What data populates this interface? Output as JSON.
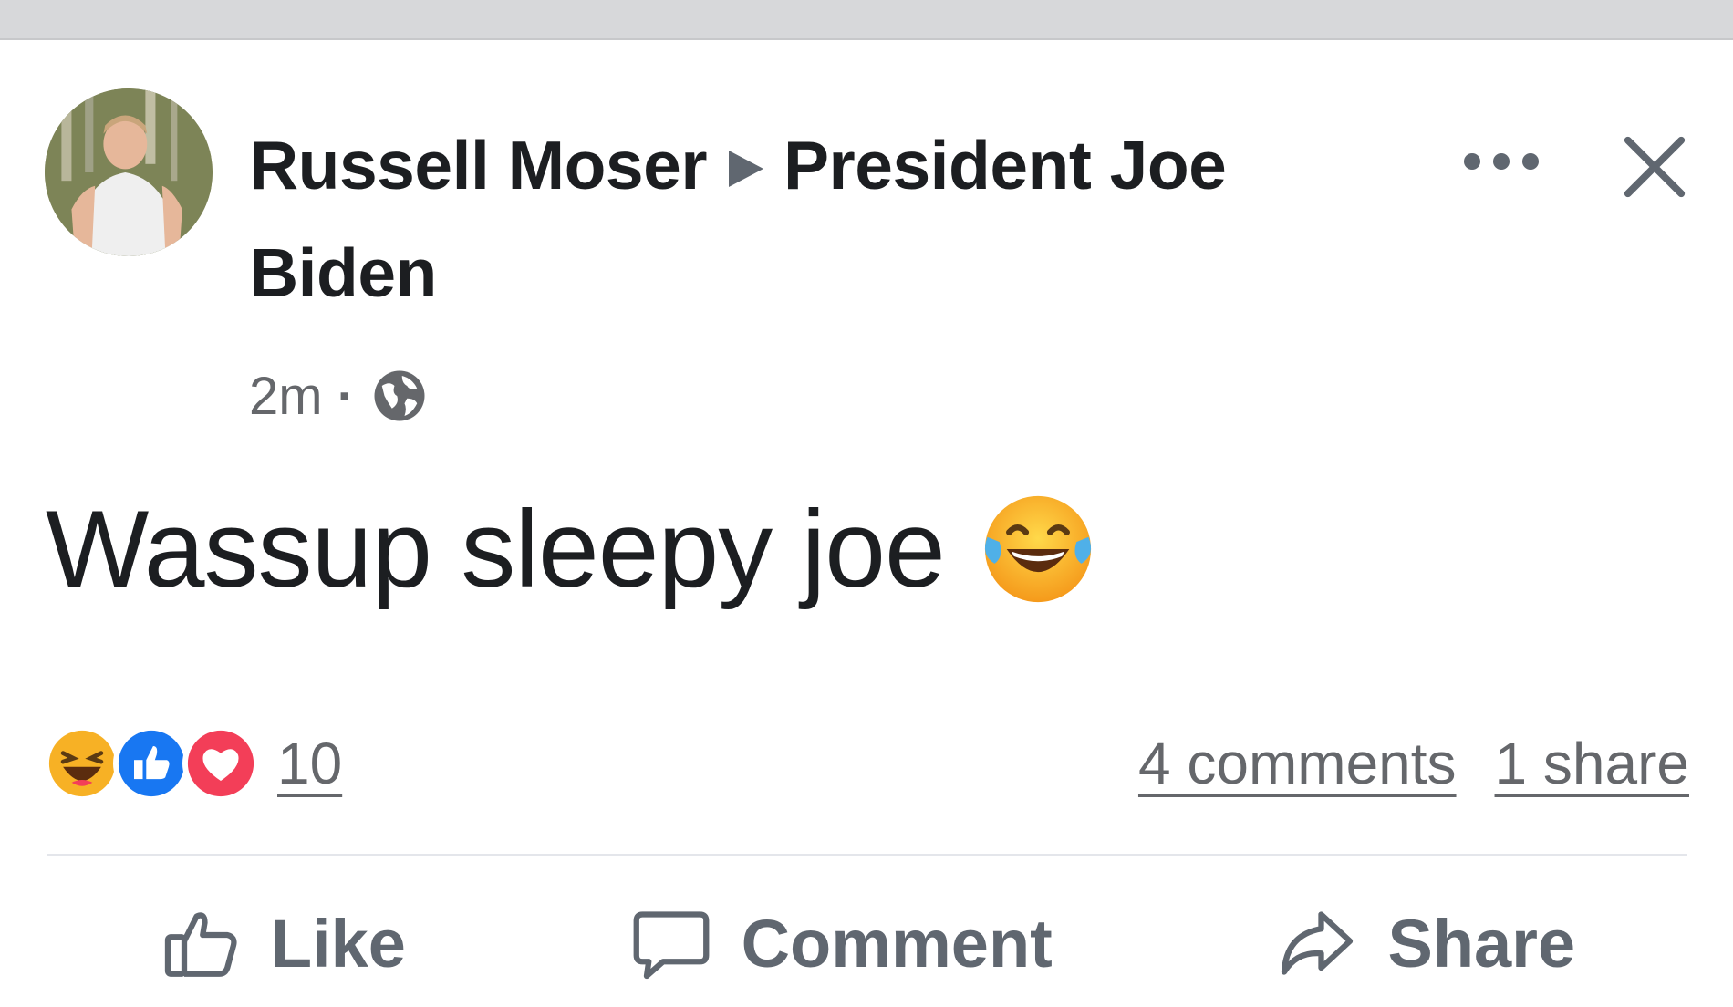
{
  "post": {
    "author": "Russell Moser",
    "target": "President Joe Biden",
    "time": "2m",
    "separator": "·",
    "text": "Wassup sleepy joe",
    "reaction_count": "10",
    "comments": "4 comments",
    "shares": "1 share"
  },
  "actions": {
    "like": "Like",
    "comment": "Comment",
    "share": "Share"
  },
  "icons": {
    "more": "more-options-icon",
    "close": "close-icon",
    "audience": "globe-icon",
    "emoji": "laughing-tears-emoji",
    "reactions": [
      "haha-reaction-icon",
      "like-reaction-icon",
      "love-reaction-icon"
    ]
  },
  "colors": {
    "text": "#1c1e21",
    "secondary": "#65676b",
    "like_blue": "#1877f2",
    "love_red": "#f33e58",
    "haha_yellow": "#f7b125"
  }
}
